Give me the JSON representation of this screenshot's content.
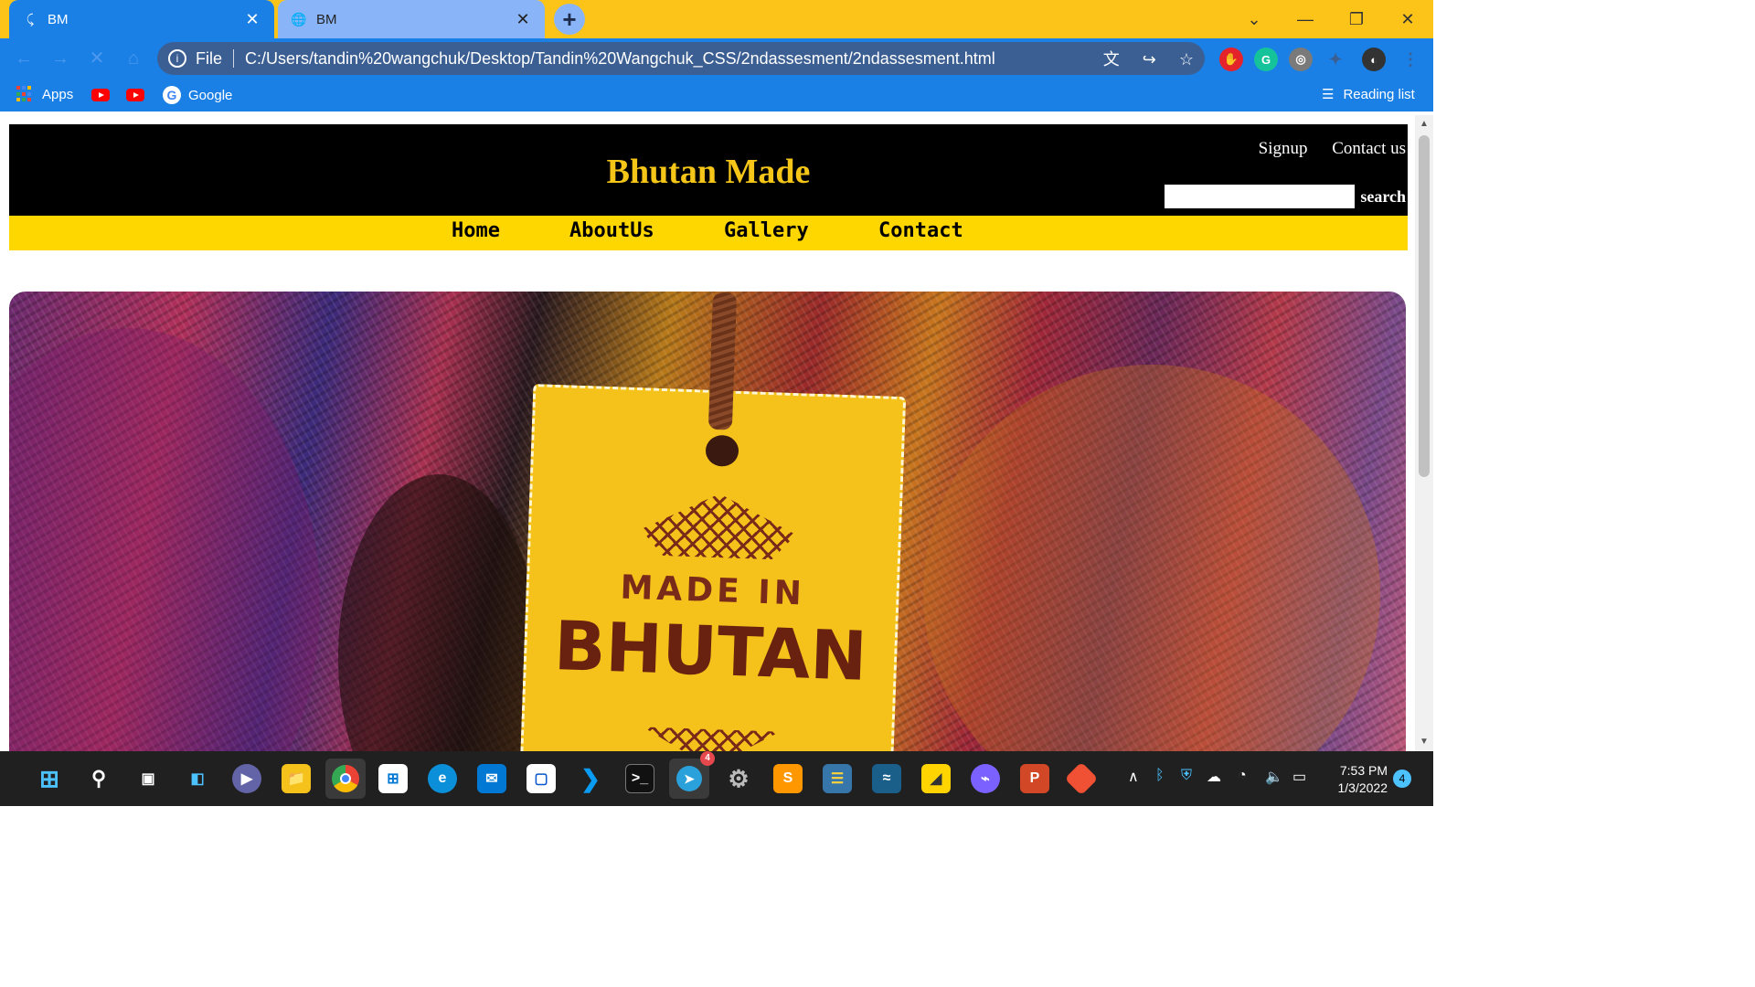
{
  "browser": {
    "tabs": [
      {
        "title": "BM",
        "icon": "loading-icon",
        "active": true
      },
      {
        "title": "BM",
        "icon": "globe-icon",
        "active": false
      }
    ],
    "address": {
      "scheme": "File",
      "url": "C:/Users/tandin%20wangchuk/Desktop/Tandin%20Wangchuk_CSS/2ndassesment/2ndassesment.html"
    },
    "bookmarks": [
      {
        "label": "Apps",
        "icon": "apps-grid-icon"
      },
      {
        "label": "",
        "icon": "youtube-icon"
      },
      {
        "label": "",
        "icon": "youtube-icon"
      },
      {
        "label": "Google",
        "icon": "google-icon"
      }
    ],
    "reading_list": "Reading list",
    "colors": {
      "tabstrip": "#fcc419",
      "toolbar": "#1a80e6"
    }
  },
  "site": {
    "title": "Bhutan Made",
    "top_links": [
      "Signup",
      "Contact us"
    ],
    "search": {
      "button_label": "search",
      "value": "",
      "placeholder": ""
    },
    "nav": [
      "Home",
      "AboutUs",
      "Gallery",
      "Contact"
    ],
    "hero": {
      "tag_line1": "MADE IN",
      "tag_line2": "BHUTAN"
    },
    "colors": {
      "header_bg": "#000000",
      "title": "#f5c518",
      "nav_bg": "#ffd700"
    }
  },
  "taskbar": {
    "apps": [
      "start-icon",
      "search-icon",
      "task-view-icon",
      "widgets-icon",
      "teams-chat-icon",
      "file-explorer-icon",
      "chrome-icon",
      "store-icon",
      "edge-icon",
      "mail-icon",
      "app-icon",
      "vscode-icon",
      "terminal-icon",
      "telegram-icon",
      "settings-icon",
      "sublime-icon",
      "python-icon",
      "mysql-workbench-icon",
      "sticky-notes-icon",
      "messenger-icon",
      "powerpoint-icon",
      "git-icon"
    ],
    "telegram_badge": "4",
    "time": "7:53 PM",
    "date": "1/3/2022",
    "notification_count": "4"
  }
}
